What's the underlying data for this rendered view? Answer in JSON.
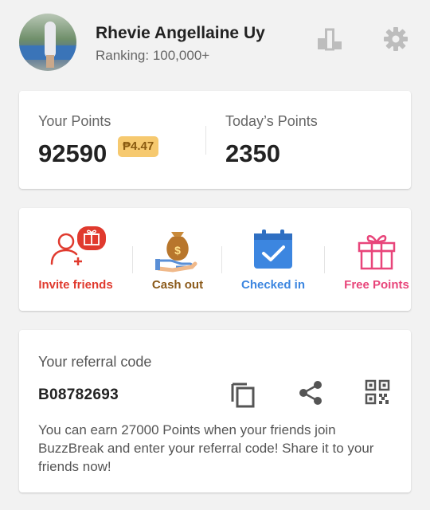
{
  "header": {
    "user_name": "Rhevie Angellaine Uy",
    "ranking": "Ranking: 100,000+",
    "icons": [
      "leaderboard-icon",
      "gear-icon"
    ]
  },
  "points": {
    "your_label": "Your Points",
    "your_value": "92590",
    "peso_value": "₱4.47",
    "today_label": "Today’s Points",
    "today_value": "2350"
  },
  "actions": [
    {
      "label": "Invite friends",
      "icon": "invite-friends-icon",
      "color": "#e03a2e"
    },
    {
      "label": "Cash out",
      "icon": "money-bag-icon",
      "color": "#8b5a1a"
    },
    {
      "label": "Checked in",
      "icon": "calendar-check-icon",
      "color": "#3c86e0"
    },
    {
      "label": "Free Points",
      "icon": "gift-icon",
      "color": "#e8457a"
    }
  ],
  "referral": {
    "title": "Your referral code",
    "code": "B08782693",
    "description": "You can earn 27000 Points when your friends join BuzzBreak and enter your referral code! Share it to your friends now!",
    "icons": [
      "copy-icon",
      "share-icon",
      "qr-code-icon"
    ]
  },
  "colors": {
    "background": "#f2f2f2",
    "card": "#ffffff",
    "badge": "#f6c96f",
    "icon_gray": "#bdbdbd"
  }
}
